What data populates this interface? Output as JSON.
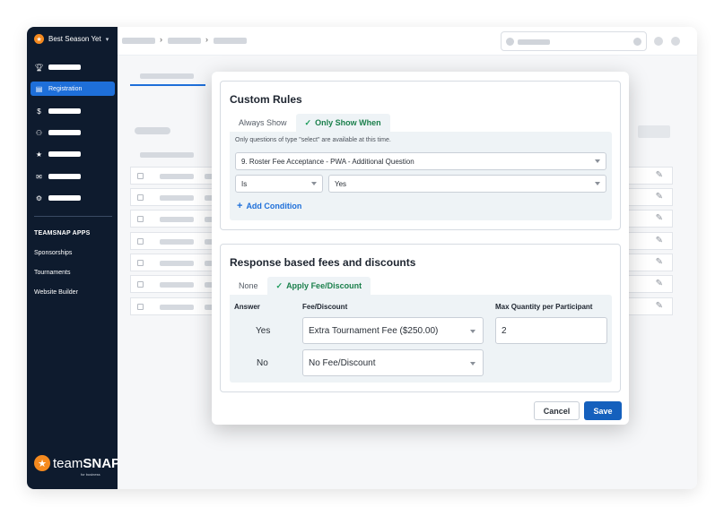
{
  "sidebar": {
    "season_label": "Best Season Yet",
    "active_item_label": "Registration",
    "apps_title": "TEAMSNAP APPS",
    "apps": [
      "Sponsorships",
      "Tournaments",
      "Website Builder"
    ],
    "brand_word_light": "team",
    "brand_word_bold": "SNAP",
    "brand_sub": "for business",
    "nav_icons": [
      "trophy-icon",
      "file-icon",
      "dollar-icon",
      "users-icon",
      "star-icon",
      "mail-icon",
      "gear-icon"
    ]
  },
  "colors": {
    "sidebar_bg": "#0e1b2e",
    "accent_blue": "#1e6fd9",
    "save_blue": "#1560bd",
    "brand_orange": "#f58a1f",
    "active_tab_green": "#1a7f4b"
  },
  "custom_rules": {
    "title": "Custom Rules",
    "tab_always": "Always Show",
    "tab_only": "Only Show When",
    "note": "Only questions of type \"select\" are available at this time.",
    "question_value": "9. Roster Fee Acceptance - PWA - Additional Question",
    "operator_value": "Is",
    "answer_value": "Yes",
    "add_condition": "Add Condition"
  },
  "fees": {
    "title": "Response based fees and discounts",
    "tab_none": "None",
    "tab_apply": "Apply Fee/Discount",
    "col_answer": "Answer",
    "col_fee": "Fee/Discount",
    "col_max": "Max Quantity per Participant",
    "rows": [
      {
        "answer": "Yes",
        "fee": "Extra Tournament Fee ($250.00)",
        "max": "2"
      },
      {
        "answer": "No",
        "fee": "No Fee/Discount",
        "max": ""
      }
    ]
  },
  "buttons": {
    "cancel": "Cancel",
    "save": "Save"
  }
}
